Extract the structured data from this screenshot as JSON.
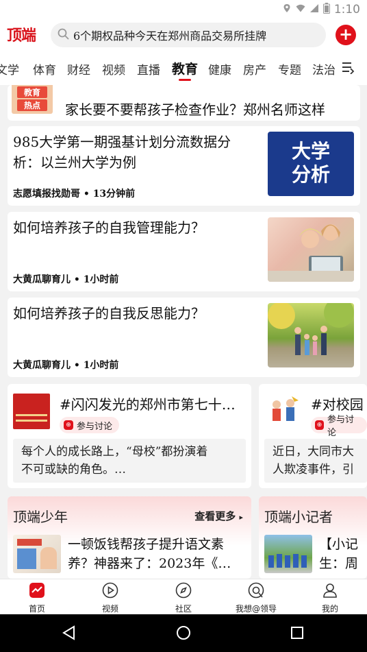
{
  "status_bar": {
    "time": "1:10"
  },
  "app": {
    "logo": "顶端",
    "search": {
      "text": "6个期权品种今天在郑州商品交易所挂牌"
    },
    "add_label": "+"
  },
  "tabs": [
    {
      "label": "文学"
    },
    {
      "label": "体育"
    },
    {
      "label": "财经"
    },
    {
      "label": "视频"
    },
    {
      "label": "直播"
    },
    {
      "label": "教育",
      "active": true
    },
    {
      "label": "健康"
    },
    {
      "label": "房产"
    },
    {
      "label": "专题"
    },
    {
      "label": "法治"
    }
  ],
  "feed": {
    "hot": {
      "badge_line1": "教育",
      "badge_line2": "热点",
      "title": "家长要不要帮孩子检查作业？郑州名师这样"
    },
    "articles": [
      {
        "title_line1": "985大学第一期强基计划分流数据分",
        "title_line2": "析：以兰州大学为例",
        "meta": "志愿填报找勋哥 • 13分钟前",
        "thumb_text_line1": "大学",
        "thumb_text_line2": "分析"
      },
      {
        "title_line1": "如何培养孩子的自我管理能力？",
        "meta": "大黄瓜聊育儿 • 1小时前"
      },
      {
        "title_line1": "如何培养孩子的自我反思能力？",
        "meta": "大黄瓜聊育儿 • 1小时前"
      }
    ]
  },
  "topics": [
    {
      "title": "#闪闪发光的郑州市第七十…",
      "pill": "参与讨论",
      "quote_line1": "每个人的成长路上，“母校”都扮演着",
      "quote_line2": "不可或缺的角色。…"
    },
    {
      "title": "#对校园",
      "pill": "参与讨论",
      "quote_line1": "近日，大同市大",
      "quote_line2": "人欺凌事件，引"
    }
  ],
  "sections": [
    {
      "title": "顶端少年",
      "see_more": "查看更多",
      "item_line1": "一顿饭钱帮孩子提升语文素",
      "item_line2": "养？神器来了：2023年《…"
    },
    {
      "title": "顶端小记者",
      "item_line1": "【小记",
      "item_line2": "生：周"
    }
  ],
  "bottom_nav": [
    {
      "label": "首页",
      "icon": "home-icon"
    },
    {
      "label": "视频",
      "icon": "play-icon"
    },
    {
      "label": "社区",
      "icon": "compass-icon"
    },
    {
      "label": "我想@领导",
      "icon": "megaphone-icon"
    },
    {
      "label": "我的",
      "icon": "user-icon"
    }
  ],
  "colors": {
    "brand": "#e0111b",
    "background": "#f2f2f2",
    "hot_badge": "#e84a3a",
    "thumb_navy": "#1b3a8c"
  }
}
